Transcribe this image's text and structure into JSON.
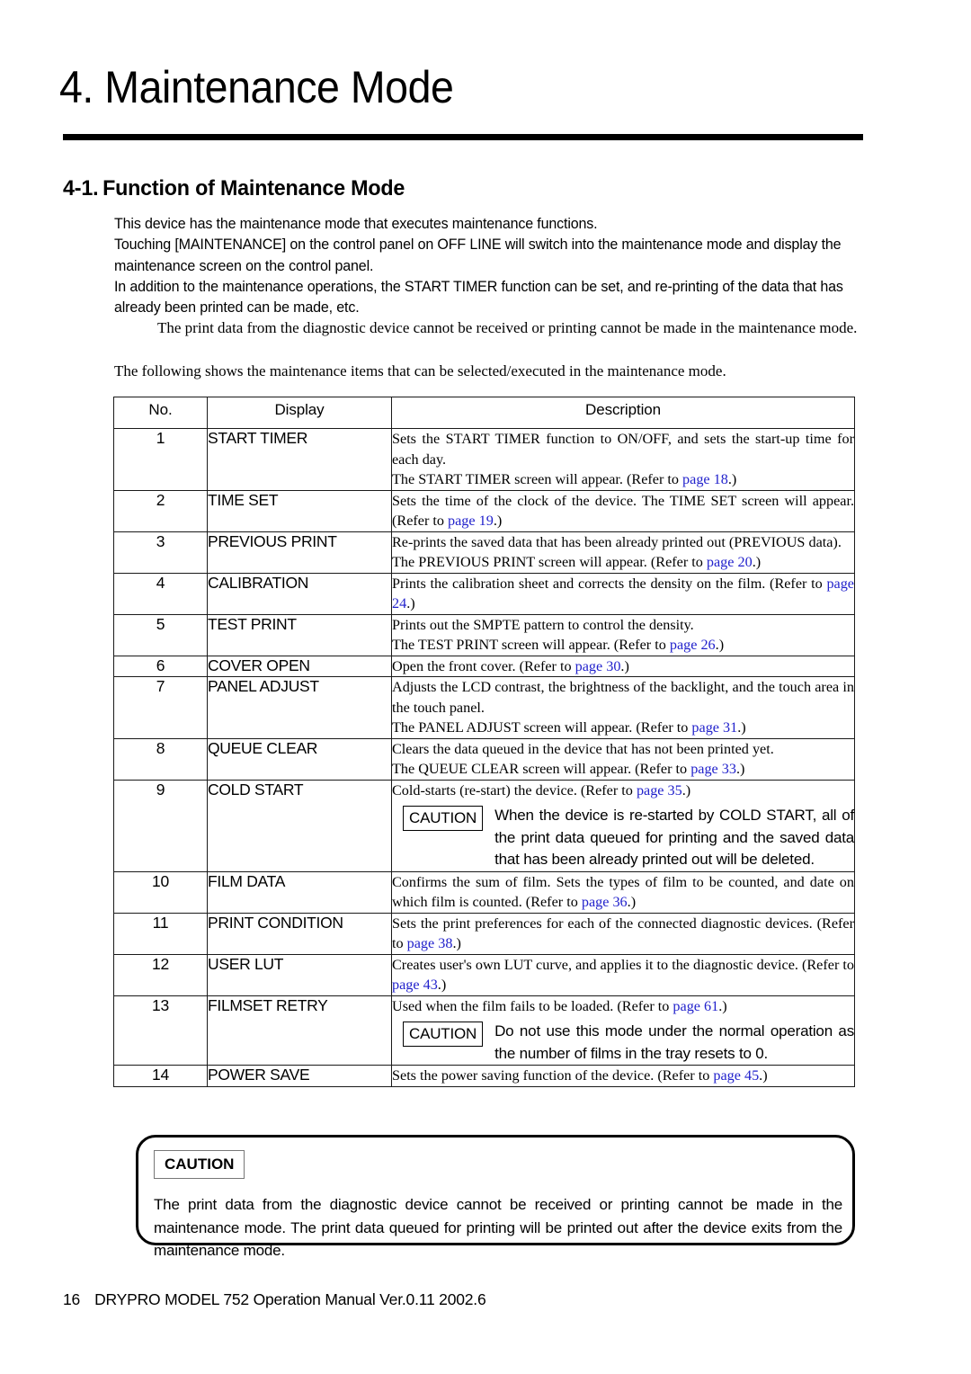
{
  "chapter": {
    "title": "4. Maintenance Mode"
  },
  "section": {
    "number": "4-1.",
    "title": "Function of Maintenance Mode"
  },
  "intro": {
    "p1": "This device has the maintenance mode that executes maintenance functions.",
    "p2": "Touching [MAINTENANCE] on the control panel on OFF LINE will switch into the maintenance mode and display the maintenance screen on the control panel.",
    "p3": "In addition to the maintenance operations, the START TIMER function can be set, and re-printing of the data that has already been printed can be made, etc.",
    "note": "The print data from the diagnostic device cannot be received or printing cannot be made in the maintenance mode.",
    "lead": "The following shows the maintenance items that can be selected/executed in the maintenance mode."
  },
  "table": {
    "headers": {
      "no": "No.",
      "display": "Display",
      "description": "Description"
    },
    "rows": [
      {
        "no": "1",
        "display": "START TIMER",
        "desc_lines": [
          "Sets the START TIMER function to ON/OFF, and sets the start-up time for each day.",
          "The START TIMER screen will appear. (Refer to "
        ],
        "desc_justify": [
          true,
          false
        ],
        "ref_line": 1,
        "ref": "page 18",
        "ref_tail": ".)"
      },
      {
        "no": "2",
        "display": "TIME SET",
        "desc_lines": [
          "Sets the time of the clock of the device. The TIME SET screen will appear. (Refer to "
        ],
        "desc_justify": [
          true
        ],
        "ref_line": 0,
        "ref": "page 19",
        "ref_tail": ".)"
      },
      {
        "no": "3",
        "display": "PREVIOUS PRINT",
        "desc_lines": [
          "Re-prints the saved data that has been already printed out (PREVIOUS data).",
          "The PREVIOUS PRINT screen will appear. (Refer to "
        ],
        "desc_justify": [
          false,
          false
        ],
        "ref_line": 1,
        "ref": "page 20",
        "ref_tail": ".)"
      },
      {
        "no": "4",
        "display": "CALIBRATION",
        "desc_lines": [
          "Prints the calibration sheet and corrects the density on the film. (Refer to "
        ],
        "desc_justify": [
          true
        ],
        "ref_line": 0,
        "ref": "page 24",
        "ref_tail": ".)"
      },
      {
        "no": "5",
        "display": "TEST PRINT",
        "desc_lines": [
          "Prints out the SMPTE pattern to control the density.",
          "The TEST PRINT screen will appear. (Refer to "
        ],
        "desc_justify": [
          false,
          false
        ],
        "ref_line": 1,
        "ref": "page 26",
        "ref_tail": ".)"
      },
      {
        "no": "6",
        "display": "COVER OPEN",
        "desc_lines": [
          "Open the front cover. (Refer to "
        ],
        "desc_justify": [
          false
        ],
        "ref_line": 0,
        "ref": "page 30",
        "ref_tail": ".)"
      },
      {
        "no": "7",
        "display": "PANEL ADJUST",
        "desc_lines": [
          "Adjusts the LCD contrast, the brightness of the backlight, and the touch area in the touch panel.",
          "The PANEL ADJUST screen will appear. (Refer to "
        ],
        "desc_justify": [
          true,
          false
        ],
        "ref_line": 1,
        "ref": "page 31",
        "ref_tail": ".)"
      },
      {
        "no": "8",
        "display": "QUEUE CLEAR",
        "desc_lines": [
          "Clears the data queued in the device that has not been printed yet.",
          "The QUEUE CLEAR screen will appear. (Refer to "
        ],
        "desc_justify": [
          false,
          false
        ],
        "ref_line": 1,
        "ref": "page 33",
        "ref_tail": ".)"
      },
      {
        "no": "9",
        "display": "COLD START",
        "desc_lines": [
          "Cold-starts (re-start) the device. (Refer to "
        ],
        "desc_justify": [
          false
        ],
        "ref_line": 0,
        "ref": "page 35",
        "ref_tail": ".)",
        "caution": {
          "label": "CAUTION",
          "text": "When the device is re-started by COLD START, all of the print data queued for printing and the saved data that has been already printed out will be deleted."
        }
      },
      {
        "no": "10",
        "display": "FILM DATA",
        "desc_lines": [
          "Confirms the sum of film. Sets the types of film to be counted, and date on which film is counted. (Refer to "
        ],
        "desc_justify": [
          true
        ],
        "ref_line": 0,
        "ref": "page 36",
        "ref_tail": ".)"
      },
      {
        "no": "11",
        "display": "PRINT CONDITION",
        "desc_lines": [
          "Sets the print preferences for each of the connected diagnostic devices. (Refer to "
        ],
        "desc_justify": [
          true
        ],
        "ref_line": 0,
        "ref": "page 38",
        "ref_tail": ".)"
      },
      {
        "no": "12",
        "display": "USER LUT",
        "desc_lines": [
          "Creates user's own LUT curve, and applies it to the diagnostic device. (Refer to "
        ],
        "desc_justify": [
          true
        ],
        "ref_line": 0,
        "ref": "page 43",
        "ref_tail": ".)"
      },
      {
        "no": "13",
        "display": "FILMSET RETRY",
        "desc_lines": [
          "Used when the film fails to be loaded. (Refer to "
        ],
        "desc_justify": [
          false
        ],
        "ref_line": 0,
        "ref": "page 61",
        "ref_tail": ".)",
        "caution": {
          "label": "CAUTION",
          "text": "Do not use this mode under the normal operation as the number of films in the tray resets to 0."
        }
      },
      {
        "no": "14",
        "display": "POWER SAVE",
        "desc_lines": [
          "Sets the power saving function of the device. (Refer to "
        ],
        "desc_justify": [
          false
        ],
        "ref_line": 0,
        "ref": "page 45",
        "ref_tail": ".)"
      }
    ]
  },
  "caution_box": {
    "label": "CAUTION",
    "text": "The print data from the diagnostic device cannot be received or printing cannot be made in the maintenance mode. The print data queued for printing will be printed out after the device exits from the maintenance mode."
  },
  "footer": {
    "page_number": "16",
    "text": "DRYPRO MODEL 752 Operation Manual Ver.0.11 2002.6"
  },
  "colors": {
    "link": "#2222cc",
    "rule": "#000000",
    "border": "#1a1a1a"
  }
}
